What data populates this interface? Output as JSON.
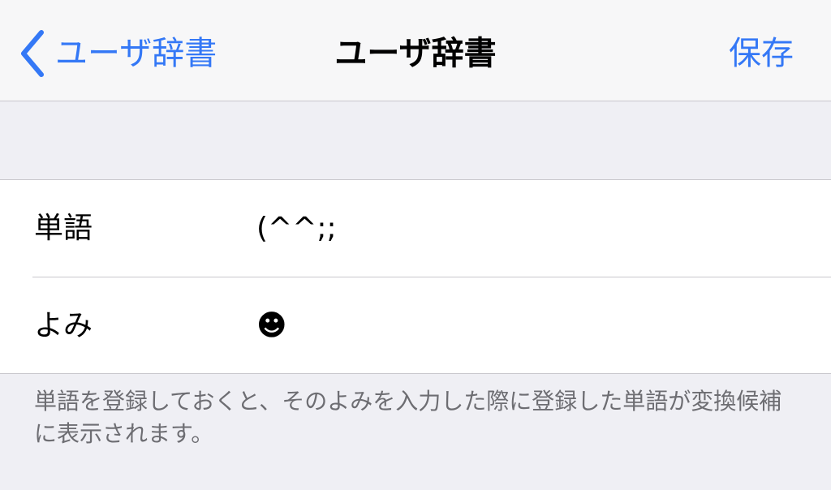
{
  "nav": {
    "back_label": "ユーザ辞書",
    "title": "ユーザ辞書",
    "save_label": "保存"
  },
  "form": {
    "word_label": "単語",
    "word_value": "(^^;;",
    "reading_label": "よみ",
    "reading_value": "☻"
  },
  "footer": {
    "note": "単語を登録しておくと、そのよみを入力した際に登録した単語が変換候補に表示されます。"
  },
  "colors": {
    "accent": "#3478f6",
    "background": "#efeff4",
    "separator": "#c8c7cc",
    "footer_text": "#6d6d72"
  },
  "icons": {
    "back": "chevron-left-icon"
  }
}
